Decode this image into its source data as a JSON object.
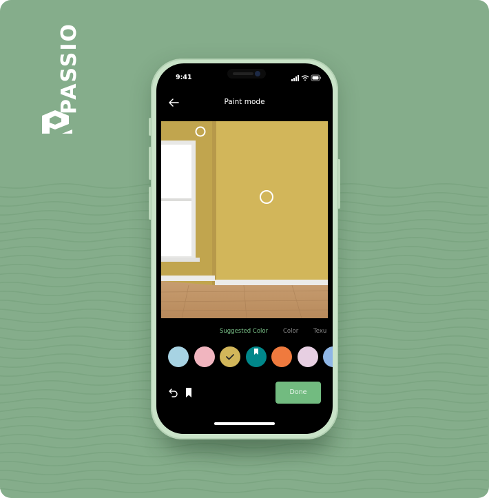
{
  "brand": {
    "logo_text": "PASSIO"
  },
  "colors": {
    "background": "#85ad8b",
    "wall": "#d2b65a",
    "accent_green": "#72bb80",
    "active_tab": "#7bc48a"
  },
  "status_bar": {
    "time": "9:41",
    "icons": [
      "signal-icon",
      "wifi-icon",
      "battery-icon"
    ]
  },
  "nav": {
    "back_icon": "arrow-left-icon",
    "title": "Paint mode"
  },
  "preview": {
    "markers": [
      "selection-circle-corner",
      "selection-circle-center"
    ]
  },
  "tabs": [
    {
      "label": "Suggested Color",
      "active": true
    },
    {
      "label": "Color",
      "active": false
    },
    {
      "label": "Texu",
      "active": false
    }
  ],
  "swatches": [
    {
      "color": "#a7d3e3",
      "selected": false,
      "bookmarked": false
    },
    {
      "color": "#f1b5bf",
      "selected": false,
      "bookmarked": false
    },
    {
      "color": "#d2b65a",
      "selected": true,
      "bookmarked": false
    },
    {
      "color": "#00878a",
      "selected": false,
      "bookmarked": true
    },
    {
      "color": "#ef7a3e",
      "selected": false,
      "bookmarked": false
    },
    {
      "color": "#e7cfe2",
      "selected": false,
      "bookmarked": false
    },
    {
      "color": "#8fb6e6",
      "selected": false,
      "bookmarked": false
    }
  ],
  "actions": {
    "undo_icon": "undo-icon",
    "bookmark_icon": "bookmark-icon",
    "done_label": "Done"
  }
}
